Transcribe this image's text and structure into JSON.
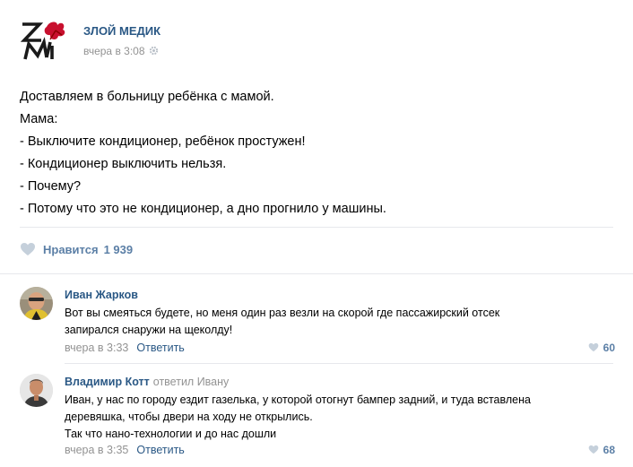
{
  "post": {
    "group_name": "ЗЛОЙ МЕДИК",
    "time": "вчера в 3:08",
    "text_lines": [
      "Доставляем в больницу ребёнка с мамой.",
      "Мама:",
      "- Выключите кондиционер, ребёнок простужен!",
      "- Кондиционер выключить нельзя.",
      "- Почему?",
      "- Потому что это не кондиционер, а дно прогнило у машины."
    ],
    "like_label": "Нравится",
    "like_count": "1 939"
  },
  "comments": [
    {
      "author": "Иван Жарков",
      "reply_to": "",
      "text_lines": [
        "Вот вы смеяться будете, но меня один раз везли на скорой где пассажирский отсек",
        "запирался снаружи на щеколду!"
      ],
      "time": "вчера в 3:33",
      "reply_label": "Ответить",
      "likes": "60"
    },
    {
      "author": "Владимир Котт",
      "reply_to": "ответил Ивану",
      "text_lines": [
        "Иван, у нас по городу ездит газелька, у которой отогнут бампер задний, и туда вставлена",
        "деревяшка, чтобы двери на ходу не открылись.",
        "Так что нано-технологии и до нас дошли"
      ],
      "time": "вчера в 3:35",
      "reply_label": "Ответить",
      "likes": "68"
    }
  ],
  "colors": {
    "link": "#2a5885",
    "muted": "#939393",
    "like": "#5b7fa6",
    "divider": "#e7e8ec"
  }
}
